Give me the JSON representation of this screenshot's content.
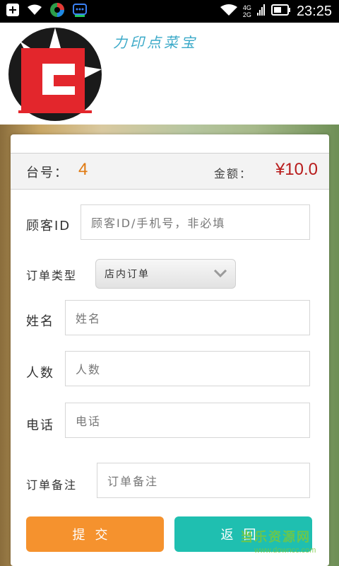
{
  "status_bar": {
    "time": "23:25",
    "network_top": "4G",
    "network_bottom": "2G",
    "icons": [
      "plus-icon",
      "wifi-icon",
      "colorful-app-icon",
      "chat-icon",
      "wifi-icon",
      "signal-icon",
      "battery-icon"
    ]
  },
  "header": {
    "app_title": "力印点菜宝"
  },
  "order_info": {
    "table_label": "台号：",
    "table_number": "4",
    "amount_label": "金额：",
    "amount_value": "¥10.0"
  },
  "form": {
    "customer_id_label": "顾客ID",
    "customer_id_placeholder": "顾客ID/手机号，非必填",
    "order_type_label": "订单类型",
    "order_type_value": "店内订单",
    "name_label": "姓名",
    "name_placeholder": "姓名",
    "people_label": "人数",
    "people_placeholder": "人数",
    "phone_label": "电话",
    "phone_placeholder": "电话",
    "remark_label": "订单备注",
    "remark_placeholder": "订单备注"
  },
  "buttons": {
    "submit": "提交",
    "back": "返回"
  },
  "watermark": {
    "text": "当乐资源网",
    "sub": "www.downcc.com"
  },
  "colors": {
    "accent_orange": "#f5922e",
    "accent_teal": "#1fbfb0",
    "amount_red": "#b81c1c",
    "table_orange": "#e07a12"
  }
}
